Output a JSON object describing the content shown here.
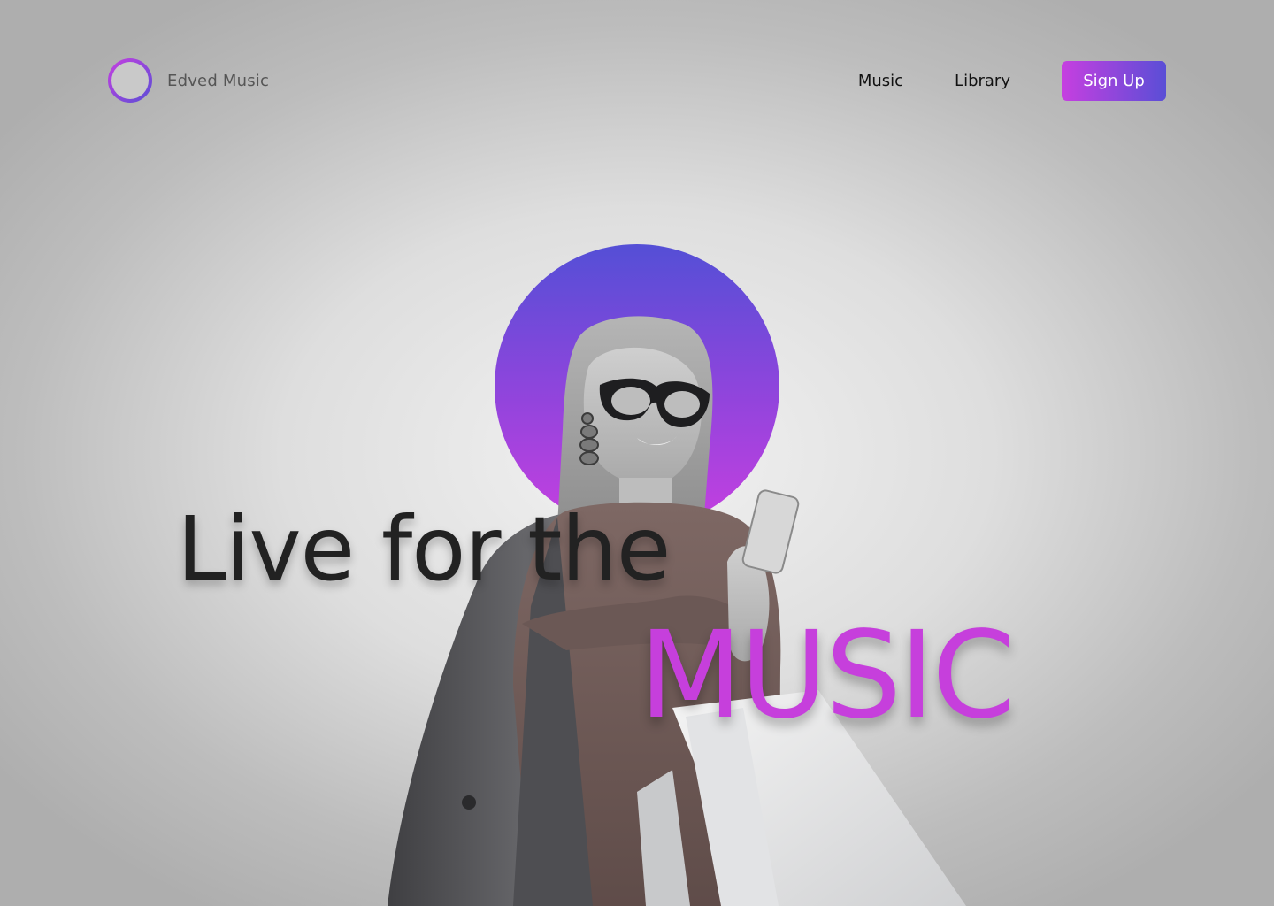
{
  "header": {
    "brand_name": "Edved Music",
    "nav": [
      {
        "label": "Music"
      },
      {
        "label": "Library"
      }
    ],
    "signup_label": "Sign Up"
  },
  "hero": {
    "headline_line1": "Live for the",
    "headline_line2": "MUSIC"
  },
  "icons": {
    "logo": "sound-wave-icon"
  },
  "colors": {
    "accent_pink": "#c63fe0",
    "accent_blue": "#5a4ed6",
    "headline_text": "#222222",
    "highlight_text": "#c63fdc"
  }
}
